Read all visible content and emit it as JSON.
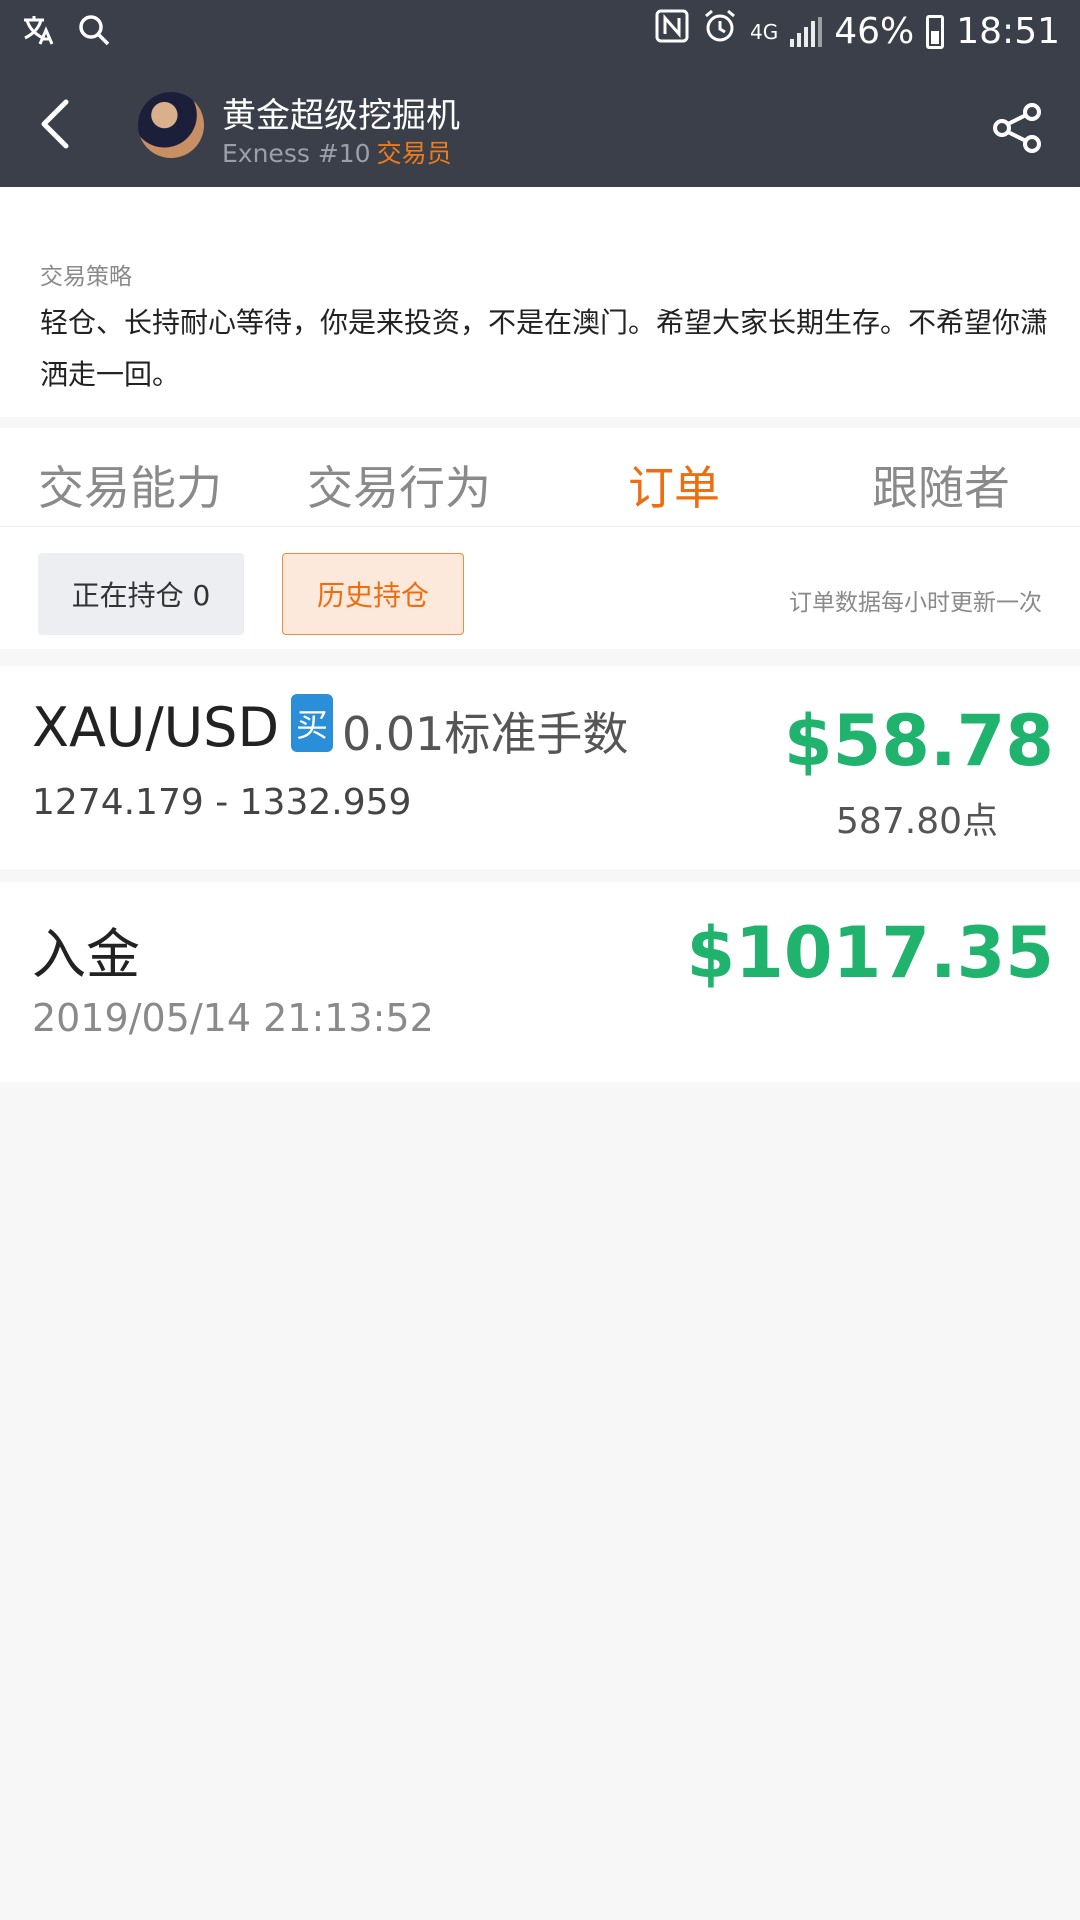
{
  "status_bar": {
    "left_icons": [
      "translate-icon",
      "search-icon"
    ],
    "right_icons": [
      "nfc-icon",
      "alarm-icon",
      "4g-icon",
      "signal-icon"
    ],
    "network": "4G",
    "battery": "46%",
    "time": "18:51"
  },
  "header": {
    "title": "黄金超级挖掘机",
    "subtitle_broker": "Exness #10",
    "subtitle_role": "交易员",
    "back_icon": "chevron-left-icon",
    "share_icon": "share-icon"
  },
  "strategy": {
    "label": "交易策略",
    "text": "轻仓、长持耐心等待，你是来投资，不是在澳门。希望大家长期生存。不希望你潇洒走一回。"
  },
  "tabs": [
    {
      "label": "交易能力",
      "active": false
    },
    {
      "label": "交易行为",
      "active": false
    },
    {
      "label": "订单",
      "active": true
    },
    {
      "label": "跟随者",
      "active": false
    }
  ],
  "filters": {
    "open_positions": "正在持仓 0",
    "history_positions": "历史持仓",
    "update_note": "订单数据每小时更新一次"
  },
  "orders": [
    {
      "symbol": "XAU/USD",
      "side_badge": "买",
      "lots": "0.01标准手数",
      "price_range": "1274.179 - 1332.959",
      "profit": "$58.78",
      "points": "587.80点"
    }
  ],
  "deposit": {
    "title": "入金",
    "time": "2019/05/14 21:13:52",
    "amount": "$1017.35"
  },
  "colors": {
    "header_bg": "#3a3f4a",
    "accent_orange": "#ee6d10",
    "profit_green": "#1fb36d",
    "buy_blue": "#2a8fd8"
  }
}
